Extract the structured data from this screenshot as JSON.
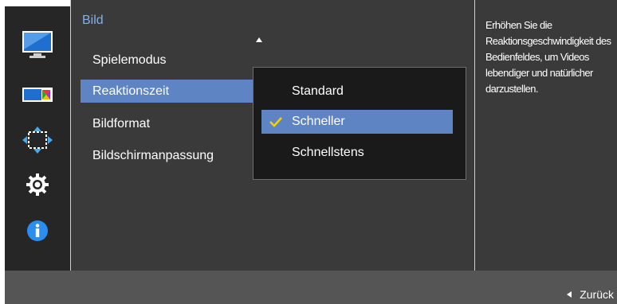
{
  "panel": {
    "title": "Bild",
    "menu_items": [
      {
        "label": "Spielemodus"
      },
      {
        "label": "Reaktionszeit"
      },
      {
        "label": "Bildformat"
      },
      {
        "label": "Bildschirmanpassung"
      }
    ],
    "selected_index": 1
  },
  "submenu": {
    "options": [
      {
        "label": "Standard"
      },
      {
        "label": "Schneller"
      },
      {
        "label": "Schnellstens"
      }
    ],
    "selected_index": 1
  },
  "help": {
    "text": "Erhöhen Sie die Reaktionsgeschwindigkeit des Bedienfeldes, um Videos lebendiger und natürlicher darzustellen."
  },
  "footer": {
    "back_label": "Zurück"
  },
  "rail_icons": [
    "picture-icon",
    "color-icon",
    "resize-icon",
    "gear-icon",
    "info-icon"
  ],
  "colors": {
    "accent": "#5f84c4",
    "title": "#7fb2ec",
    "panel_bg": "#3a3a3a",
    "submenu_bg": "#1a1a1a",
    "check": "#f5d000"
  }
}
